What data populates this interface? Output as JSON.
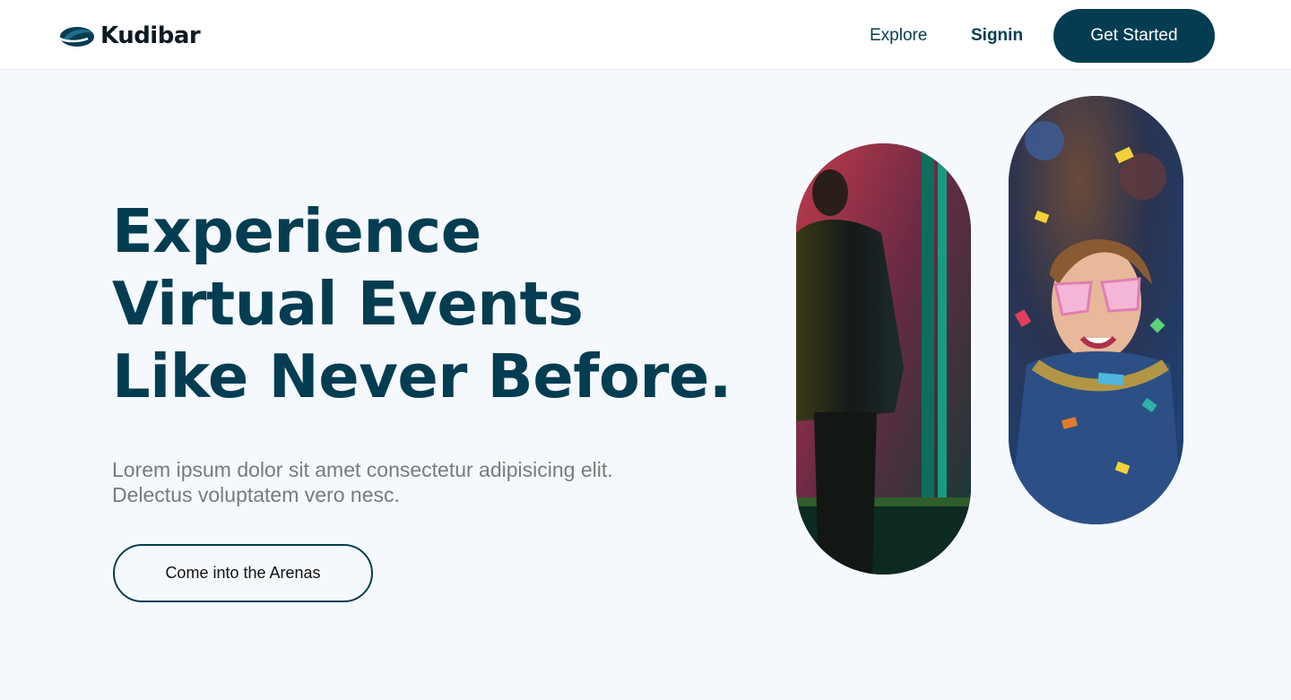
{
  "brand": {
    "name": "Kudibar",
    "logo_icon": "kudibar-logo-icon",
    "color": "#043d52"
  },
  "nav": {
    "explore_label": "Explore",
    "signin_label": "Signin",
    "cta_label": "Get Started"
  },
  "hero": {
    "title_lines": [
      "Experience",
      "Virtual Events",
      "Like Never Before."
    ],
    "description_lines": [
      "Lorem ipsum dolor sit amet consectetur adipisicing elit.",
      "Delectus voluptatem vero nesc."
    ],
    "cta_label": "Come into the Arenas"
  },
  "colors": {
    "primary": "#043d52",
    "background": "#f5f9fd",
    "muted_text": "#7a7a7a"
  }
}
